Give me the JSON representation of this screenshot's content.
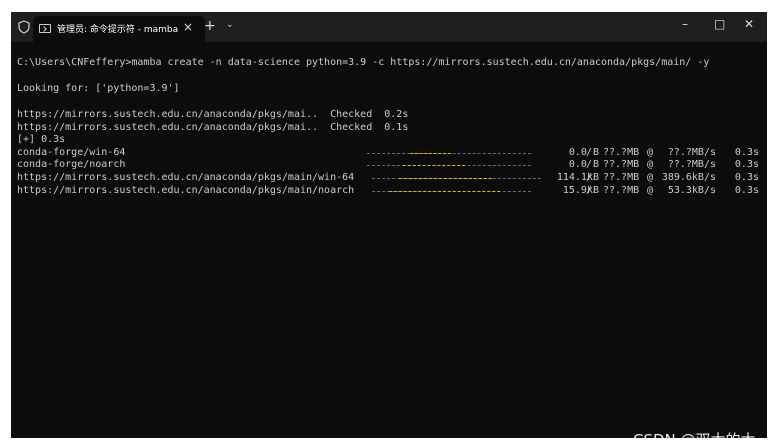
{
  "window": {
    "tab_title": "管理员: 命令提示符 - mamba",
    "tab_close": "×",
    "new_tab": "+",
    "dropdown": "⌄",
    "minimize": "–",
    "maximize": "□",
    "close": "✕"
  },
  "terminal": {
    "command": "C:\\Users\\CNFeffery>mamba create -n data-science python=3.9 -c https://mirrors.sustech.edu.cn/anaconda/pkgs/main/ -y",
    "looking_for": "Looking for: ['python=3.9']",
    "checks": [
      {
        "text": "https://mirrors.sustech.edu.cn/anaconda/pkgs/mai..  Checked  0.2s"
      },
      {
        "text": "https://mirrors.sustech.edu.cn/anaconda/pkgs/mai..  Checked  0.1s"
      }
    ],
    "summary": "[+] 0.3s",
    "downloads": [
      {
        "name": "conda-forge/win-64",
        "progress": 0.25,
        "size": "0.0 B",
        "total": "??.?MB",
        "speed": "??.?MB/s",
        "time": "0.3s"
      },
      {
        "name": "conda-forge/noarch",
        "progress": 0.38,
        "size": "0.0 B",
        "total": "??.?MB",
        "speed": "??.?MB/s",
        "time": "0.3s"
      },
      {
        "name": "https://mirrors.sustech.edu.cn/anaconda/pkgs/main/win-64",
        "progress": 0.55,
        "size": "114.1kB",
        "total": "??.?MB",
        "speed": "389.6kB/s",
        "time": "0.3s"
      },
      {
        "name": "https://mirrors.sustech.edu.cn/anaconda/pkgs/main/noarch",
        "progress": 0.7,
        "size": "15.9kB",
        "total": "??.?MB",
        "speed": "53.3kB/s",
        "time": "0.3s"
      }
    ]
  },
  "watermark": "CSDN @双木的木"
}
